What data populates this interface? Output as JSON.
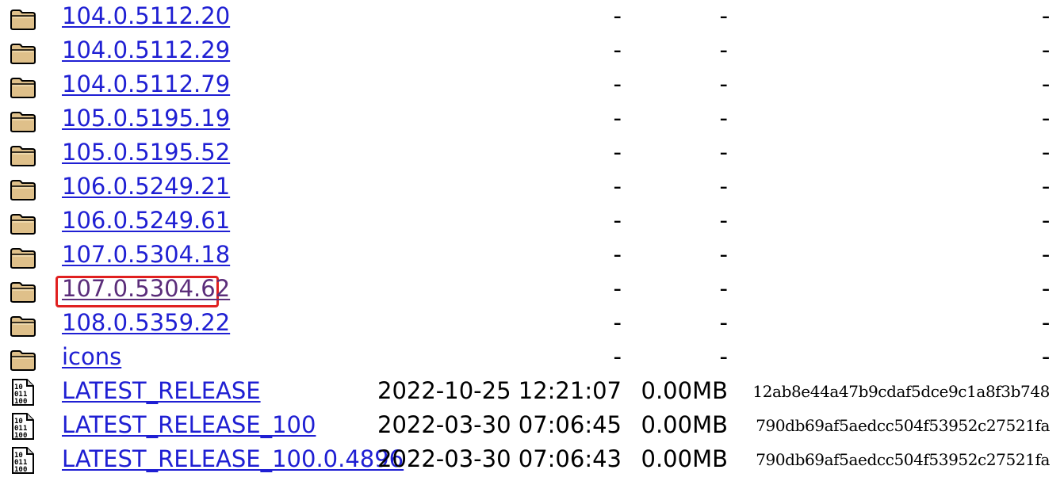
{
  "icons": {
    "folder": "folder-icon",
    "binary": "binary-file-icon"
  },
  "colors": {
    "link": "#1f1fd3",
    "visited_link": "#5b2d7a",
    "highlight": "#e02020",
    "folder_fill": "#dfc08a"
  },
  "entries": [
    {
      "name": "104.0.5112.20",
      "type": "folder",
      "date": "-",
      "size": "-",
      "hash": "-"
    },
    {
      "name": "104.0.5112.29",
      "type": "folder",
      "date": "-",
      "size": "-",
      "hash": "-"
    },
    {
      "name": "104.0.5112.79",
      "type": "folder",
      "date": "-",
      "size": "-",
      "hash": "-"
    },
    {
      "name": "105.0.5195.19",
      "type": "folder",
      "date": "-",
      "size": "-",
      "hash": "-"
    },
    {
      "name": "105.0.5195.52",
      "type": "folder",
      "date": "-",
      "size": "-",
      "hash": "-"
    },
    {
      "name": "106.0.5249.21",
      "type": "folder",
      "date": "-",
      "size": "-",
      "hash": "-"
    },
    {
      "name": "106.0.5249.61",
      "type": "folder",
      "date": "-",
      "size": "-",
      "hash": "-"
    },
    {
      "name": "107.0.5304.18",
      "type": "folder",
      "date": "-",
      "size": "-",
      "hash": "-"
    },
    {
      "name": "107.0.5304.62",
      "type": "folder",
      "date": "-",
      "size": "-",
      "hash": "-",
      "highlighted": true,
      "visited": true
    },
    {
      "name": "108.0.5359.22",
      "type": "folder",
      "date": "-",
      "size": "-",
      "hash": "-"
    },
    {
      "name": "icons",
      "type": "folder",
      "date": "-",
      "size": "-",
      "hash": "-"
    },
    {
      "name": "LATEST_RELEASE",
      "type": "binary",
      "date": "2022-10-25 12:21:07",
      "size": "0.00MB",
      "hash": "12ab8e44a47b9cdaf5dce9c1a8f3b748"
    },
    {
      "name": "LATEST_RELEASE_100",
      "type": "binary",
      "date": "2022-03-30 07:06:45",
      "size": "0.00MB",
      "hash": "790db69af5aedcc504f53952c27521fa"
    },
    {
      "name": "LATEST_RELEASE_100.0.4896",
      "type": "binary",
      "date": "2022-03-30 07:06:43",
      "size": "0.00MB",
      "hash": "790db69af5aedcc504f53952c27521fa"
    }
  ]
}
